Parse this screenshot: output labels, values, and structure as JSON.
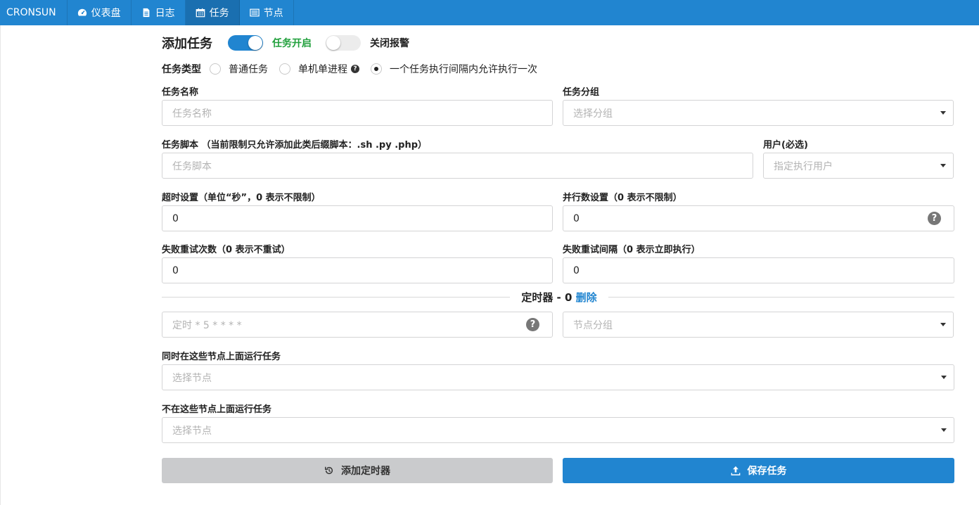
{
  "nav": {
    "brand": "CRONSUN",
    "items": [
      {
        "label": "仪表盘",
        "icon": "dashboard-icon"
      },
      {
        "label": "日志",
        "icon": "file-text-icon"
      },
      {
        "label": "任务",
        "icon": "calendar-icon",
        "active": true
      },
      {
        "label": "节点",
        "icon": "server-icon"
      }
    ]
  },
  "header": {
    "title": "添加任务",
    "toggle_job": {
      "label": "任务开启",
      "on": true
    },
    "toggle_alarm": {
      "label": "关闭报警",
      "on": false
    }
  },
  "job_type": {
    "label": "任务类型",
    "options": [
      {
        "label": "普通任务",
        "checked": false
      },
      {
        "label": "单机单进程",
        "checked": false,
        "help": "?"
      },
      {
        "label": "一个任务执行间隔内允许执行一次",
        "checked": true
      }
    ]
  },
  "fields": {
    "name": {
      "label": "任务名称",
      "placeholder": "任务名称"
    },
    "group": {
      "label": "任务分组",
      "placeholder": "选择分组"
    },
    "script": {
      "label": "任务脚本 （当前限制只允许添加此类后缀脚本：.sh .py .php）",
      "placeholder": "任务脚本"
    },
    "user": {
      "label": "用户(必选)",
      "placeholder": "指定执行用户"
    },
    "timeout": {
      "label": "超时设置（单位“秒”，0 表示不限制）",
      "value": "0"
    },
    "parallels": {
      "label": "并行数设置（0 表示不限制）",
      "value": "0",
      "help": "?"
    },
    "retry": {
      "label": "失败重试次数（0 表示不重试）",
      "value": "0"
    },
    "interval": {
      "label": "失败重试间隔（0 表示立即执行）",
      "value": "0"
    }
  },
  "timer": {
    "heading": "定时器 - 0 ",
    "delete_label": "删除",
    "spec_placeholder": "定时 * 5 * * * *",
    "spec_help": "?",
    "node_group_placeholder": "节点分组",
    "include_label": "同时在这些节点上面运行任务",
    "include_placeholder": "选择节点",
    "exclude_label": "不在这些节点上面运行任务",
    "exclude_placeholder": "选择节点"
  },
  "buttons": {
    "add_timer": "添加定时器",
    "save": "保存任务"
  },
  "colors": {
    "primary": "#2185d0",
    "success": "#21a03c",
    "button_grey": "#cacbcd"
  }
}
